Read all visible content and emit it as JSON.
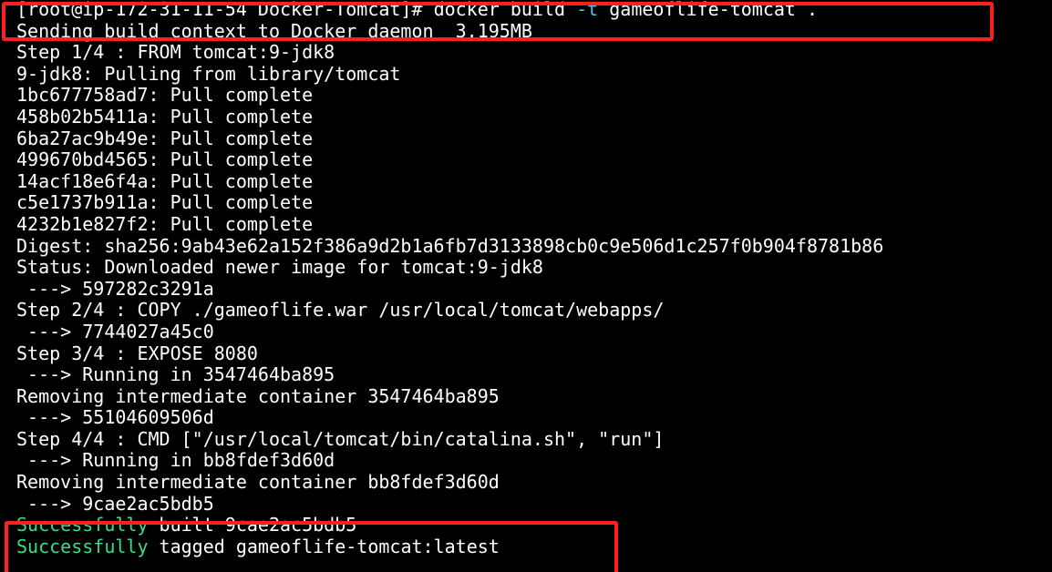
{
  "terminal": {
    "prompt": "[root@ip-172-31-11-54 Docker-Tomcat]# ",
    "command_pre": "docker build ",
    "command_flag": "-t",
    "command_post": " gameoflife-tomcat .",
    "lines": [
      "Sending build context to Docker daemon  3.195MB",
      "Step 1/4 : FROM tomcat:9-jdk8",
      "9-jdk8: Pulling from library/tomcat",
      "1bc677758ad7: Pull complete",
      "458b02b5411a: Pull complete",
      "6ba27ac9b49e: Pull complete",
      "499670bd4565: Pull complete",
      "14acf18e6f4a: Pull complete",
      "c5e1737b911a: Pull complete",
      "4232b1e827f2: Pull complete",
      "Digest: sha256:9ab43e62a152f386a9d2b1a6fb7d3133898cb0c9e506d1c257f0b904f8781b86",
      "Status: Downloaded newer image for tomcat:9-jdk8",
      " ---> 597282c3291a",
      "Step 2/4 : COPY ./gameoflife.war /usr/local/tomcat/webapps/",
      " ---> 7744027a45c0",
      "Step 3/4 : EXPOSE 8080",
      " ---> Running in 3547464ba895",
      "Removing intermediate container 3547464ba895",
      " ---> 55104609506d",
      "Step 4/4 : CMD [\"/usr/local/tomcat/bin/catalina.sh\", \"run\"]",
      " ---> Running in bb8fdef3d60d",
      "Removing intermediate container bb8fdef3d60d",
      " ---> 9cae2ac5bdb5"
    ],
    "success_built_word": "Successfully",
    "success_built_rest": " built 9cae2ac5bdb5",
    "success_tagged_word": "Successfully",
    "success_tagged_rest": " tagged gameoflife-tomcat:latest"
  },
  "colors": {
    "background": "#000000",
    "text": "#ffffff",
    "flag": "#4fc3f7",
    "success": "#3ddc84",
    "highlight": "#ff1f1f"
  }
}
